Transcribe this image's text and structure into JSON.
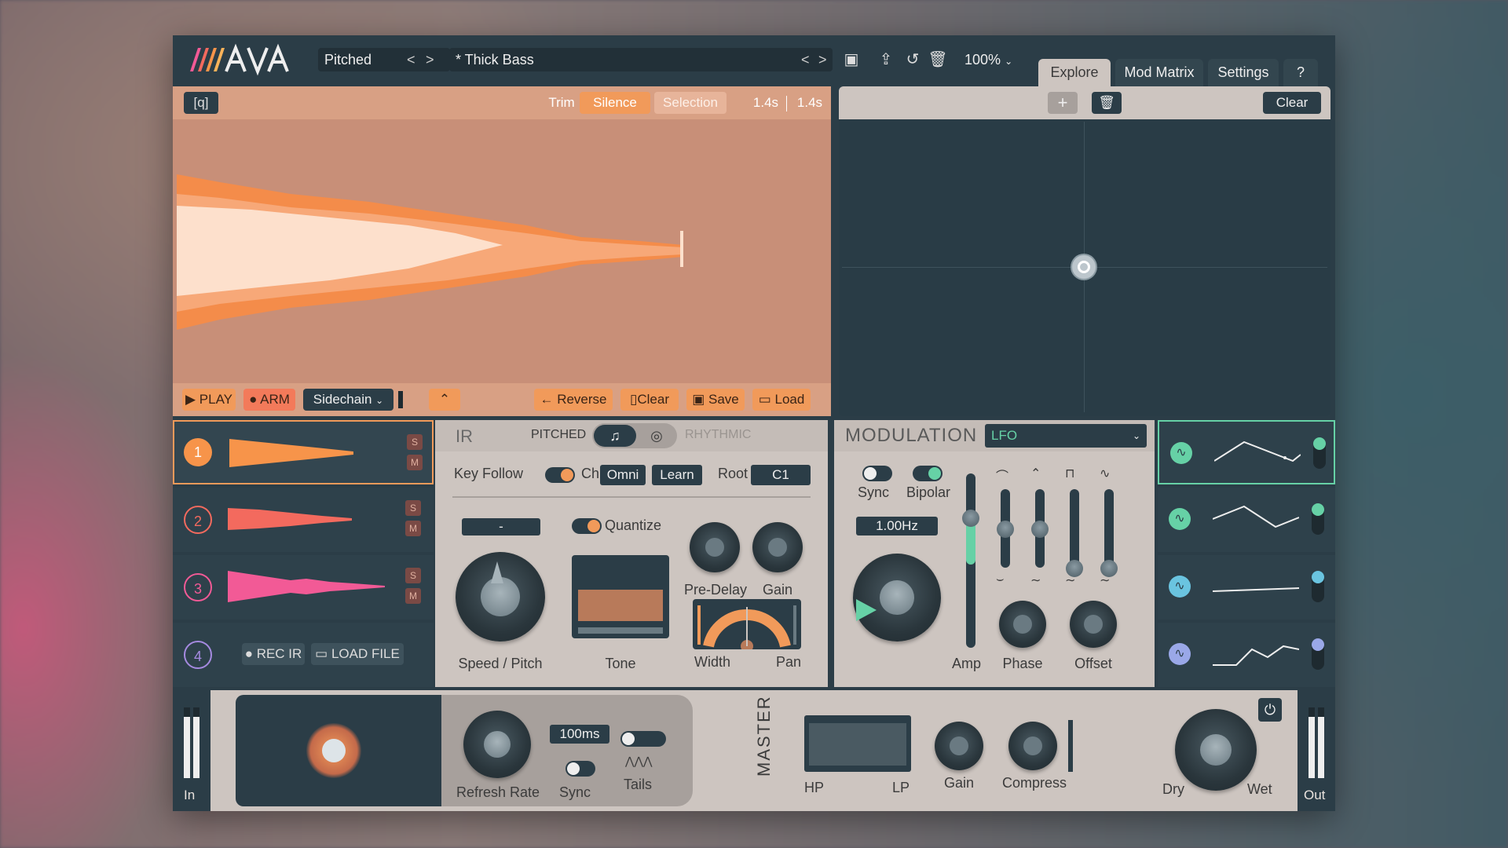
{
  "header": {
    "mode": "Pitched",
    "preset_name": "* Thick Bass",
    "zoom": "100%",
    "tabs": [
      "Explore",
      "Mod Matrix",
      "Settings",
      "?"
    ],
    "active_tab": "Explore"
  },
  "sample": {
    "zoom_icon": "[q]",
    "trim": "Trim",
    "silence": "Silence",
    "selection": "Selection",
    "len1": "1.4s",
    "len2": "1.4s",
    "play": "PLAY",
    "arm": "ARM",
    "sidechain": "Sidechain",
    "reverse": "Reverse",
    "clear": "Clear",
    "save": "Save",
    "load": "Load"
  },
  "xy": {
    "clear": "Clear"
  },
  "slots": {
    "items": [
      {
        "num": "1",
        "s": "S",
        "m": "M",
        "color": "#f7944a"
      },
      {
        "num": "2",
        "s": "S",
        "m": "M",
        "color": "#f36a5e"
      },
      {
        "num": "3",
        "s": "S",
        "m": "M",
        "color": "#f25a96"
      },
      {
        "num": "4"
      }
    ],
    "rec_ir": "REC IR",
    "load_file": "LOAD FILE"
  },
  "ir": {
    "title": "IR",
    "pitched": "PITCHED",
    "rhythmic": "RHYTHMIC",
    "key_follow": "Key Follow",
    "ch": "Ch",
    "omni": "Omni",
    "learn": "Learn",
    "root": "Root",
    "root_val": "C1",
    "dash": "-",
    "quantize": "Quantize",
    "speed_pitch": "Speed / Pitch",
    "tone": "Tone",
    "pre_delay": "Pre-Delay",
    "gain": "Gain",
    "width": "Width",
    "pan": "Pan"
  },
  "modulation": {
    "title": "MODULATION",
    "source": "LFO",
    "sync": "Sync",
    "bipolar": "Bipolar",
    "rate": "1.00Hz",
    "amp": "Amp",
    "phase": "Phase",
    "offset": "Offset"
  },
  "bottom": {
    "in": "In",
    "out": "Out",
    "refresh_rate": "Refresh Rate",
    "refresh_val": "100ms",
    "sync": "Sync",
    "tails": "Tails",
    "master": "MASTER",
    "hp": "HP",
    "lp": "LP",
    "gain": "Gain",
    "compress": "Compress",
    "dry": "Dry",
    "wet": "Wet"
  },
  "colors": {
    "accent_orange": "#f19a5a",
    "panel_dark": "#2b3d47",
    "panel_light": "#cdc5c0",
    "mod_green": "#66d1a6"
  }
}
